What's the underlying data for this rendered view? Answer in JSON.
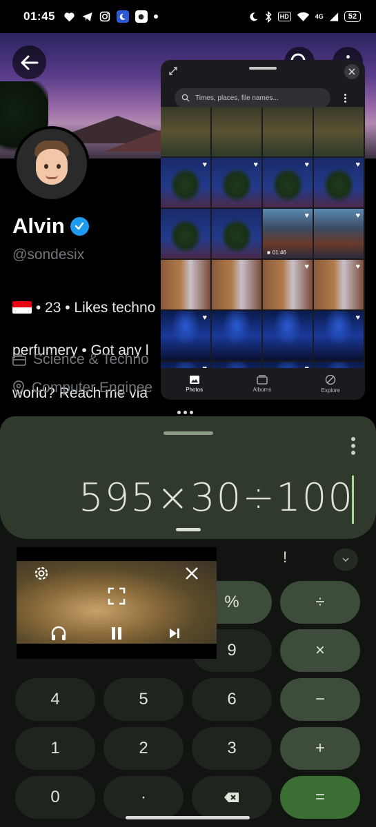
{
  "status_bar": {
    "time": "01:45",
    "network": "4G",
    "hd": "HD",
    "battery": "52",
    "notification_icons": [
      "heart-icon",
      "telegram-icon",
      "instagram-icon",
      "moon-app-icon",
      "app-icon",
      "dot-icon"
    ],
    "system_icons": [
      "moon-icon",
      "bluetooth-icon",
      "hd-icon",
      "wifi-icon",
      "signal-icon",
      "battery-icon"
    ]
  },
  "twitter": {
    "name": "Alvin",
    "handle": "@sondesix",
    "bio_line1": "• 23 • Likes techno",
    "bio_line2": "perfumery • Got any l",
    "bio_line3": "world? Reach me via",
    "category": "Science & Techno",
    "location": "Computer Enginee"
  },
  "photos": {
    "search_placeholder": "Times, places, file names...",
    "video_duration": "01:46",
    "nav": [
      {
        "label": "Photos",
        "icon": "photos-icon"
      },
      {
        "label": "Albums",
        "icon": "albums-icon"
      },
      {
        "label": "Explore",
        "icon": "explore-icon"
      }
    ],
    "grid": [
      [
        "street",
        "street",
        "street",
        "street"
      ],
      [
        "tree",
        "tree",
        "tree",
        "tree"
      ],
      [
        "tree",
        "tree",
        "mall",
        "mall"
      ],
      [
        "store",
        "store",
        "store",
        "store"
      ],
      [
        "arch",
        "arch",
        "arch",
        "arch"
      ],
      [
        "arch",
        "arch",
        "arch",
        "arch"
      ]
    ]
  },
  "calculator": {
    "expression": "595×30÷100",
    "sci_key": "!",
    "keys": {
      "percent": "%",
      "divide": "÷",
      "nine": "9",
      "multiply": "×",
      "four": "4",
      "five": "5",
      "six": "6",
      "minus": "−",
      "one": "1",
      "two": "2",
      "three": "3",
      "plus": "+",
      "zero": "0",
      "decimal": "·",
      "equals": "="
    },
    "colors": {
      "display_bg": "#2f3a2d",
      "number_key": "#1f241e",
      "operator_key": "#3e4d3b",
      "equals_key": "#3b6e33"
    }
  },
  "pip_player": {
    "controls": [
      "settings-icon",
      "close-icon",
      "fullscreen-icon",
      "headphones-icon",
      "pause-icon",
      "skip-next-icon"
    ]
  }
}
